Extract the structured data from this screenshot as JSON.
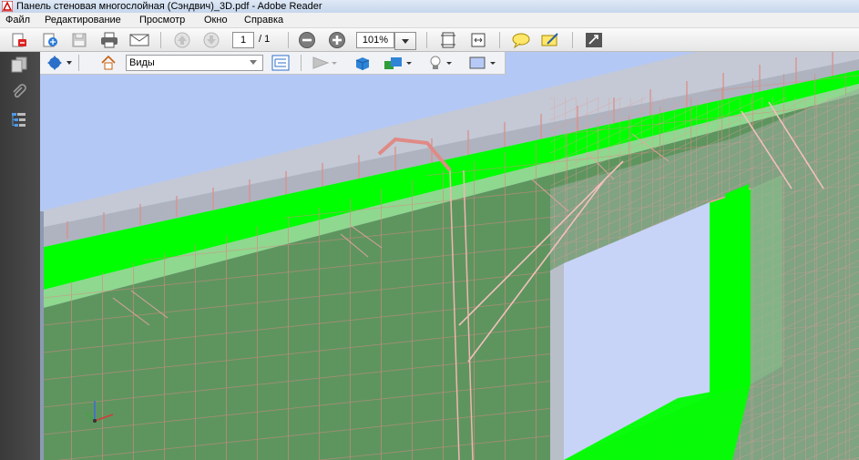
{
  "window": {
    "title": "Панель стеновая многослойная (Сэндвич)_3D.pdf - Adobe Reader"
  },
  "menu": {
    "items": [
      {
        "label": "Файл"
      },
      {
        "label": "Редактирование"
      },
      {
        "label": "Просмотр"
      },
      {
        "label": "Окно"
      },
      {
        "label": "Справка"
      }
    ]
  },
  "toolbar": {
    "page_current": "1",
    "page_total": "/ 1",
    "zoom": "101%",
    "icons": [
      "create-pdf-icon",
      "collaborate-icon",
      "save-icon",
      "print-icon",
      "email-icon",
      "prev-page-icon",
      "next-page-icon",
      "zoom-out-icon",
      "zoom-in-icon",
      "fit-page-icon",
      "fit-width-icon",
      "comment-icon",
      "sign-icon",
      "expand-icon"
    ]
  },
  "toolbar3d": {
    "views_label": "Виды",
    "icons": [
      "rotate-tool-icon",
      "home-view-icon",
      "model-tree-icon",
      "play-animation-icon",
      "projection-icon",
      "render-mode-icon",
      "lighting-icon",
      "background-color-icon"
    ]
  },
  "sidebar": {
    "icons": [
      "pages-icon",
      "attachments-icon",
      "model-tree-icon"
    ]
  },
  "colors": {
    "insulation": "#00ff00",
    "concrete": "#5b8f5a",
    "rebar": "#e88a88",
    "background": "#b4c8f5"
  }
}
